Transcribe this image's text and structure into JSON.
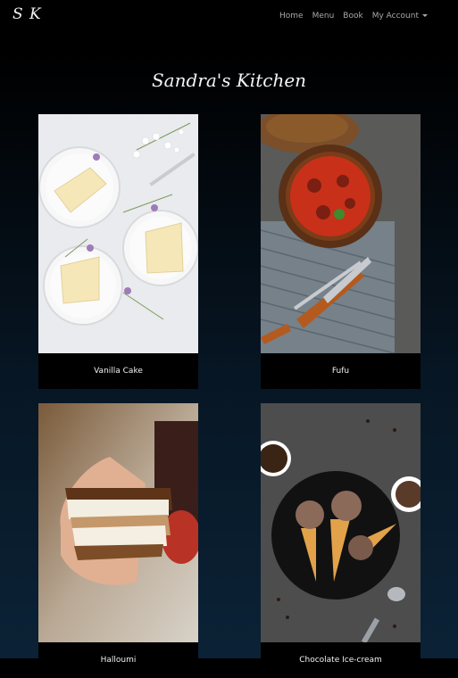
{
  "nav": {
    "brand": "S K",
    "items": [
      "Home",
      "Menu",
      "Book"
    ],
    "account": "My Account"
  },
  "page_title": "Sandra's Kitchen",
  "cards": [
    {
      "title": "Vanilla Cake",
      "image_alt": "vanilla cake slices on plates"
    },
    {
      "title": "Fufu",
      "image_alt": "bowl of red stew with cutlery"
    },
    {
      "title": "Halloumi",
      "image_alt": "hand holding grilled sandwich"
    },
    {
      "title": "Chocolate Ice-cream",
      "image_alt": "chocolate ice cream cones on a dark plate"
    }
  ]
}
